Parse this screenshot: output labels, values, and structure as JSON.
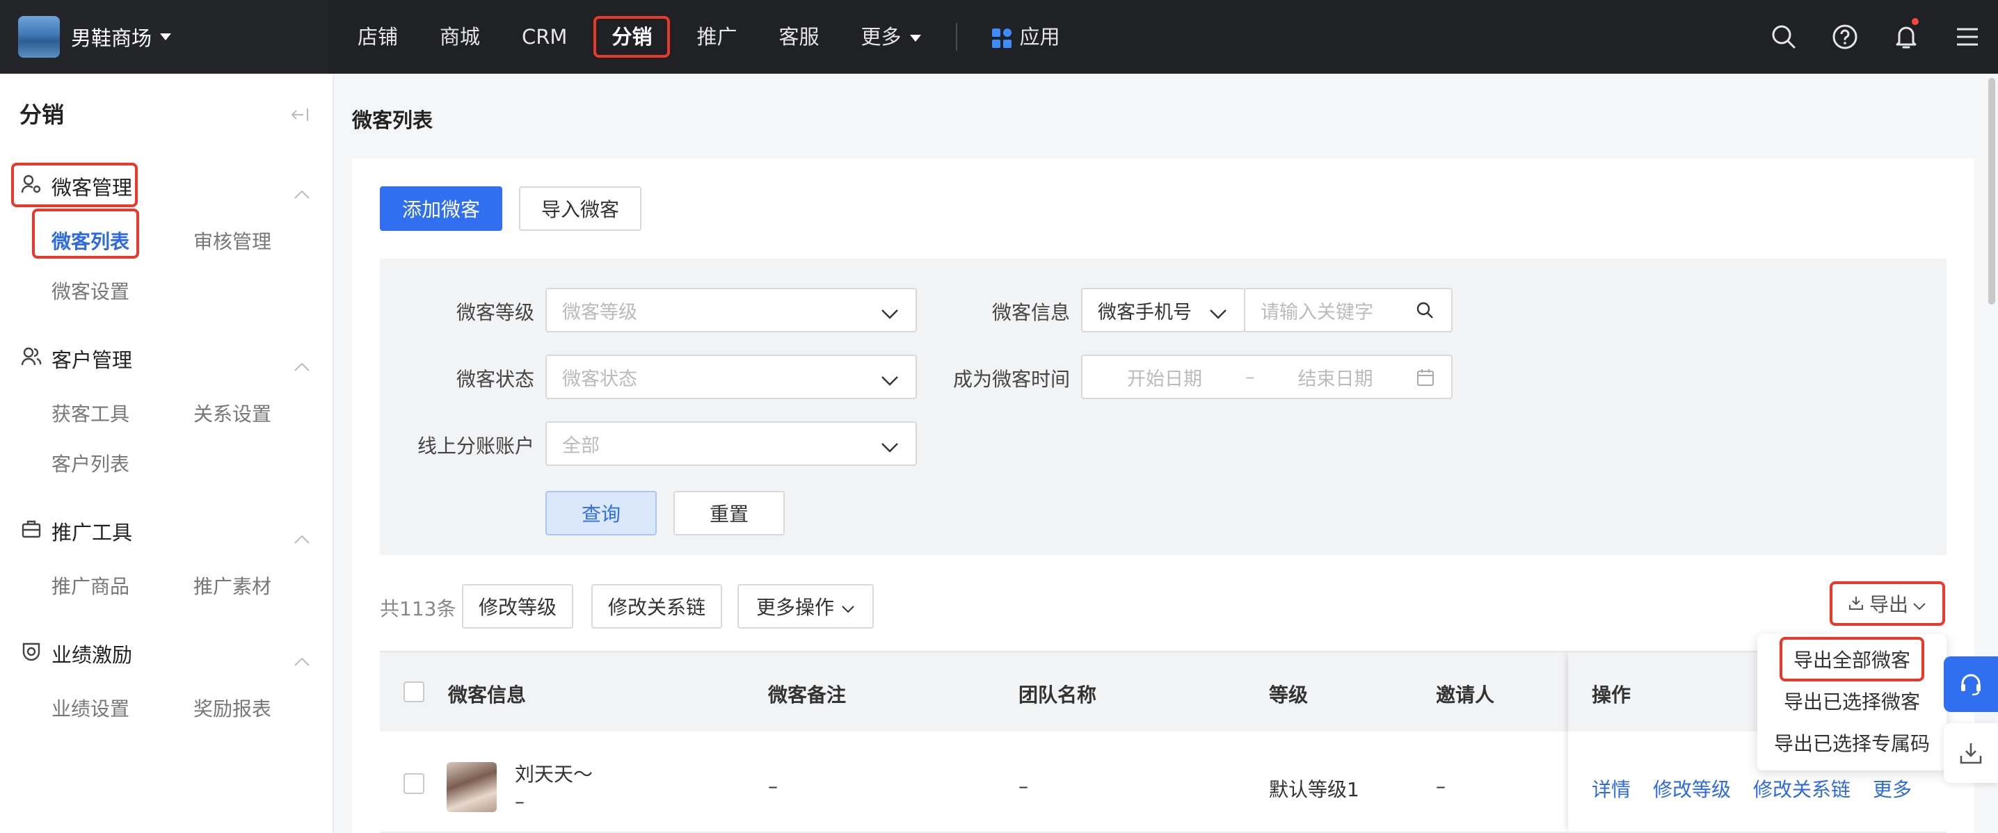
{
  "topbar": {
    "shop_name": "男鞋商场",
    "nav": [
      "店铺",
      "商城",
      "CRM",
      "分销",
      "推广",
      "客服",
      "更多"
    ],
    "apps_label": "应用"
  },
  "sidebar": {
    "title": "分销",
    "groups": [
      {
        "label": "微客管理",
        "icon": "user-gear-icon",
        "items": [
          "微客列表",
          "审核管理",
          "微客设置"
        ]
      },
      {
        "label": "客户管理",
        "icon": "users-icon",
        "items": [
          "获客工具",
          "关系设置",
          "客户列表"
        ]
      },
      {
        "label": "推广工具",
        "icon": "toolbox-icon",
        "items": [
          "推广商品",
          "推广素材"
        ]
      },
      {
        "label": "业绩激励",
        "icon": "medal-icon",
        "items": [
          "业绩设置",
          "奖励报表"
        ]
      }
    ]
  },
  "page": {
    "title": "微客列表",
    "add_button": "添加微客",
    "import_button": "导入微客"
  },
  "filters": {
    "level_label": "微客等级",
    "level_placeholder": "微客等级",
    "status_label": "微客状态",
    "status_placeholder": "微客状态",
    "account_label": "线上分账账户",
    "account_value": "全部",
    "info_label": "微客信息",
    "info_type": "微客手机号",
    "keyword_placeholder": "请输入关键字",
    "time_label": "成为微客时间",
    "start_placeholder": "开始日期",
    "range_sep": "–",
    "end_placeholder": "结束日期",
    "query_button": "查询",
    "reset_button": "重置"
  },
  "toolbar": {
    "total": "共113条",
    "modify_level": "修改等级",
    "modify_chain": "修改关系链",
    "more_ops": "更多操作",
    "export": "导出",
    "export_menu": [
      "导出全部微客",
      "导出已选择微客",
      "导出已选择专属码"
    ]
  },
  "table": {
    "columns": [
      "微客信息",
      "微客备注",
      "团队名称",
      "等级",
      "邀请人",
      "操作"
    ],
    "rows": [
      {
        "name": "刘天天～",
        "sub": "–",
        "remark": "–",
        "team": "–",
        "level": "默认等级1",
        "inviter": "–",
        "actions": [
          "详情",
          "修改等级",
          "修改关系链",
          "更多"
        ]
      }
    ]
  },
  "colors": {
    "primary": "#2f6ff0",
    "highlight_box": "#e8392b",
    "topbar_bg": "#1f2124"
  }
}
